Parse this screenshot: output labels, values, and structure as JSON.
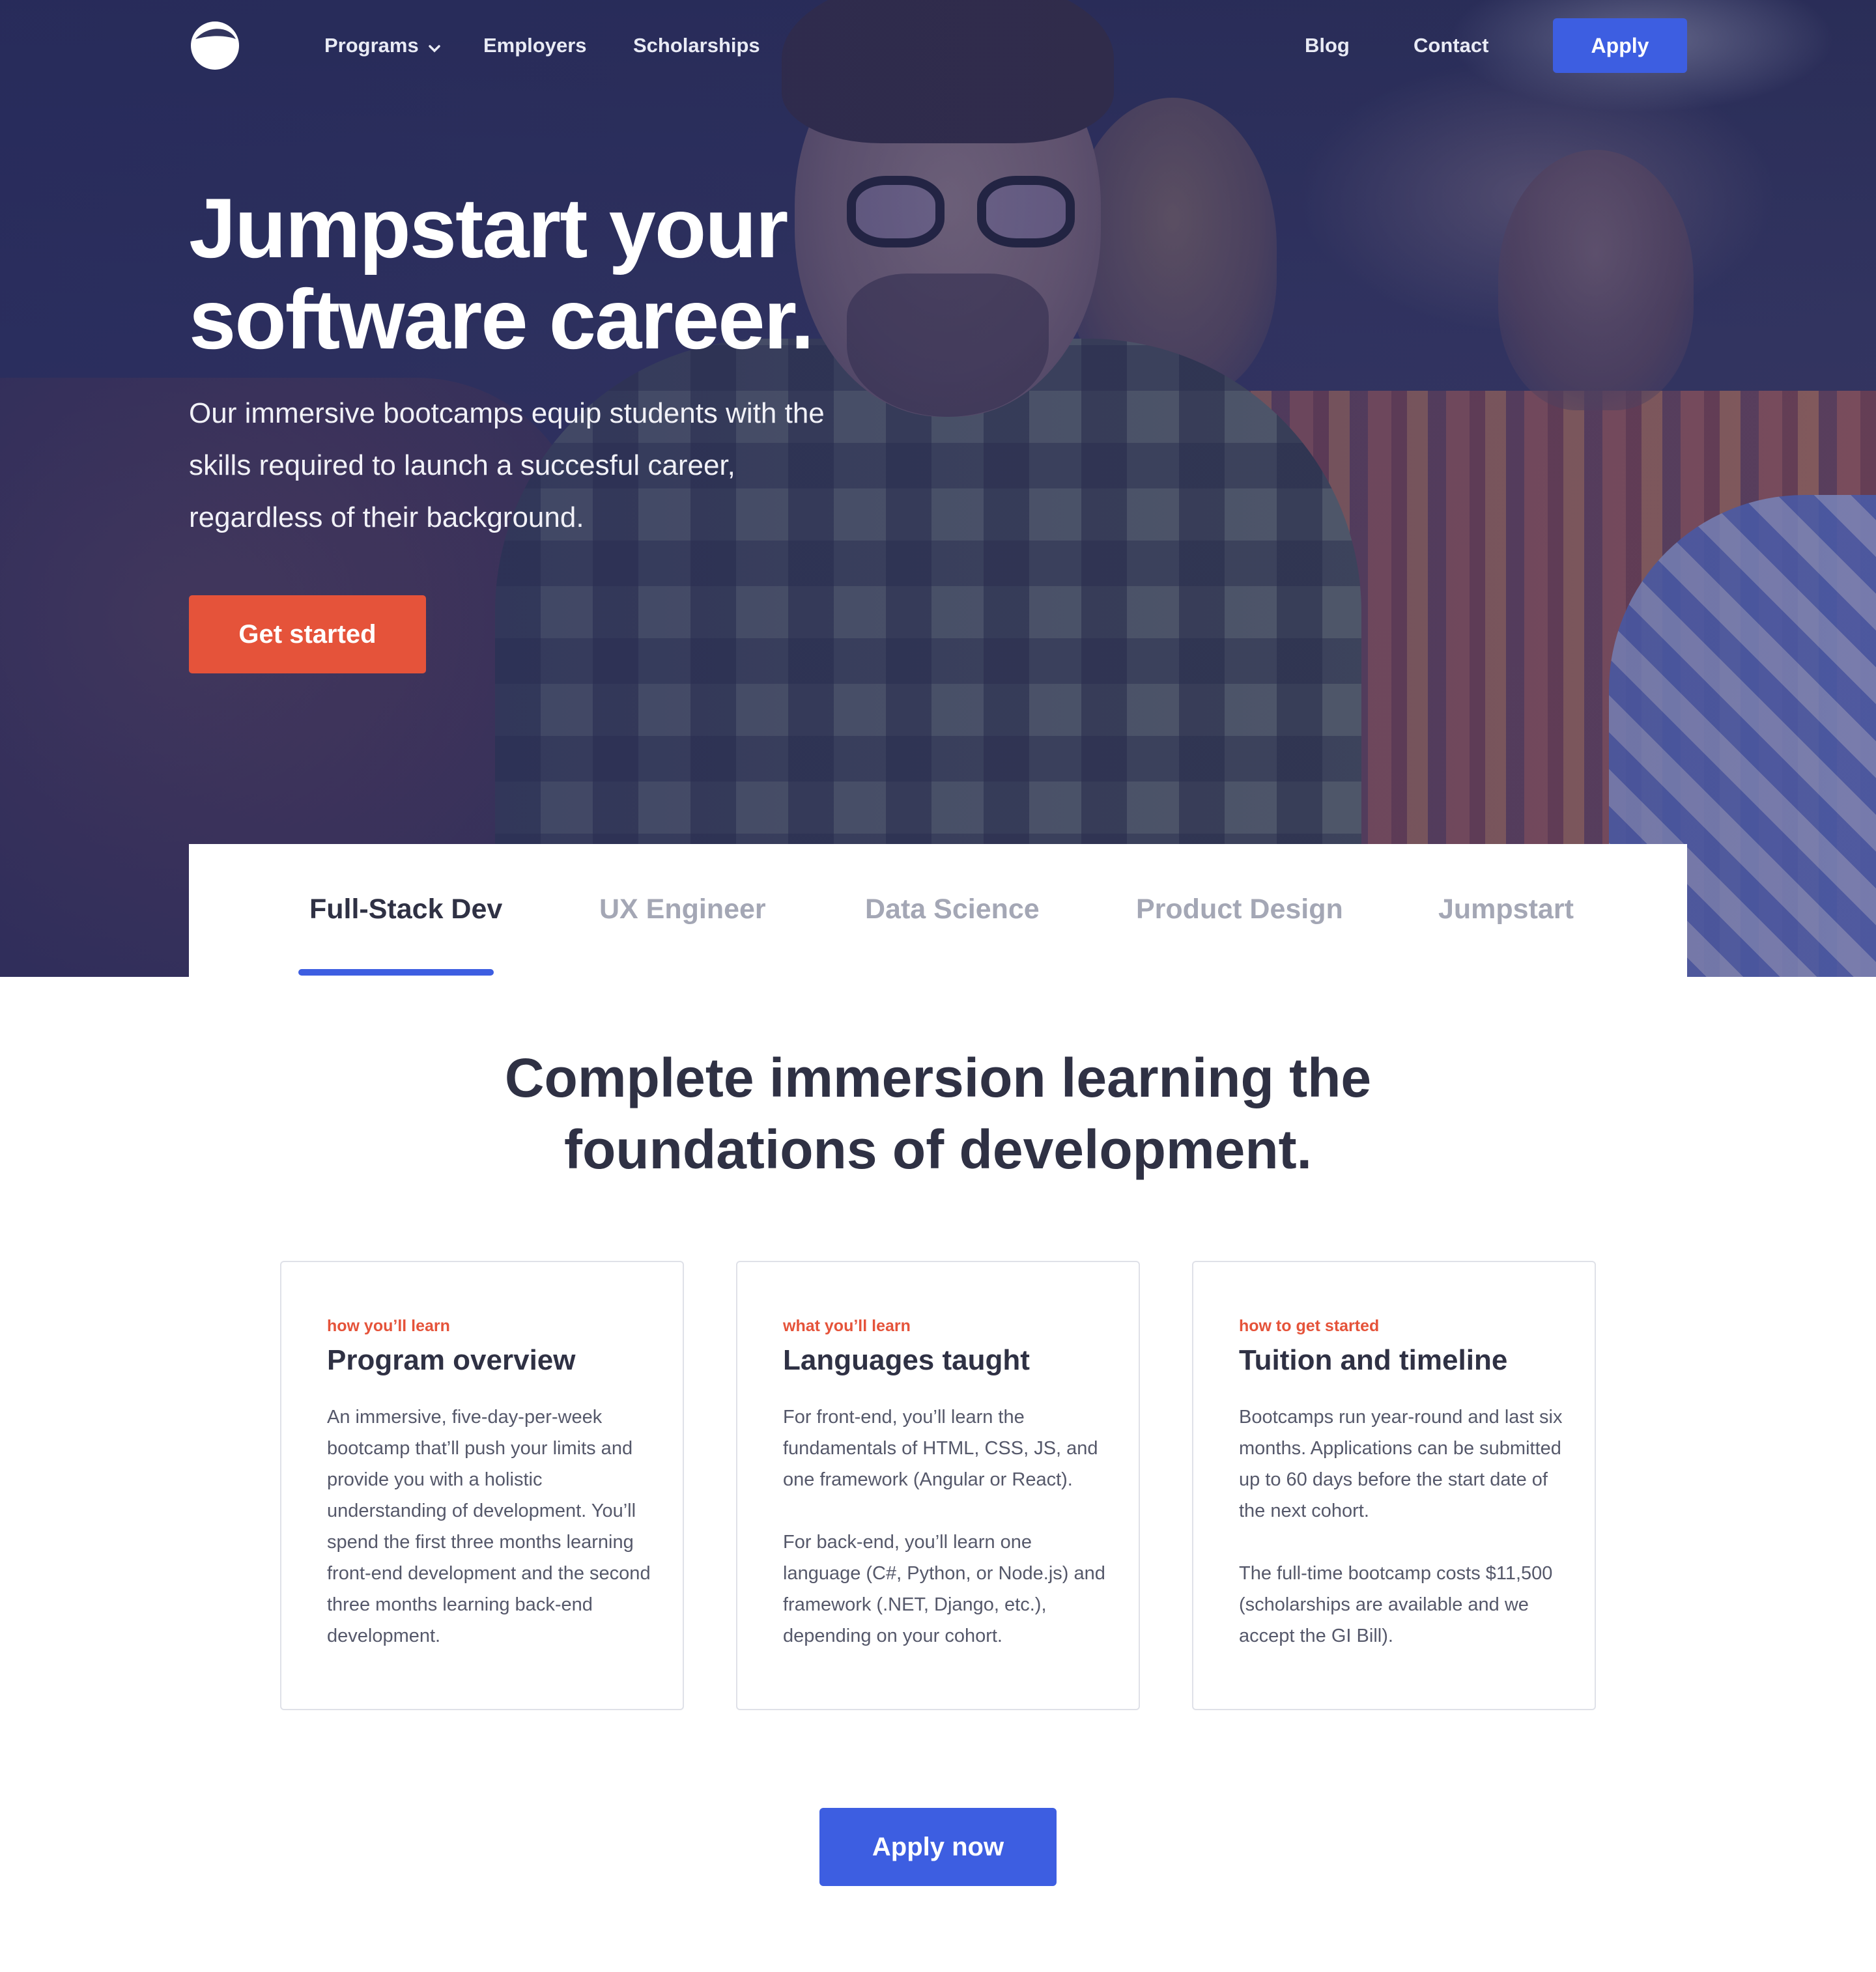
{
  "nav": {
    "logo_icon": "ring-logo-icon",
    "programs_label": "Programs",
    "programs_chevron_icon": "chevron-down-icon",
    "employers_label": "Employers",
    "scholarships_label": "Scholarships",
    "blog_label": "Blog",
    "contact_label": "Contact",
    "apply_label": "Apply"
  },
  "hero": {
    "title_line1": "Jumpstart your",
    "title_line2": "software career.",
    "subtitle": "Our immersive bootcamps equip students with the skills required to launch a succesful career, regardless of their background.",
    "cta_label": "Get started"
  },
  "tabs": {
    "active_index": 0,
    "items": [
      {
        "label": "Full-Stack Dev"
      },
      {
        "label": "UX Engineer"
      },
      {
        "label": "Data Science"
      },
      {
        "label": "Product Design"
      },
      {
        "label": "Jumpstart"
      }
    ]
  },
  "section": {
    "title_line1": "Complete immersion learning the",
    "title_line2": "foundations of development."
  },
  "cards": [
    {
      "eyebrow": "how you’ll learn",
      "title": "Program overview",
      "paragraphs": [
        "An immersive, five-day-per-week bootcamp that’ll push your limits and provide you with a holistic understanding of development. You’ll spend the first three months learning front-end development and the second three months learning back-end development."
      ]
    },
    {
      "eyebrow": "what you’ll learn",
      "title": "Languages taught",
      "paragraphs": [
        "For front-end, you’ll learn the fundamentals of HTML, CSS, JS, and one framework (Angular or React).",
        "For back-end, you’ll learn one language (C#, Python, or Node.js) and framework (.NET, Django, etc.), depending on your cohort."
      ]
    },
    {
      "eyebrow": "how to get started",
      "title": "Tuition and timeline",
      "paragraphs": [
        "Bootcamps run year-round and last six months. Applications can be submitted up to 60 days before the start date of the next cohort.",
        "The full-time bootcamp costs $11,500 (scholarships are available and we accept the GI Bill)."
      ]
    }
  ],
  "apply_now_label": "Apply now",
  "colors": {
    "accent_blue": "#3d5ee1",
    "accent_orange": "#e5533a",
    "text_dark": "#2f3144"
  }
}
